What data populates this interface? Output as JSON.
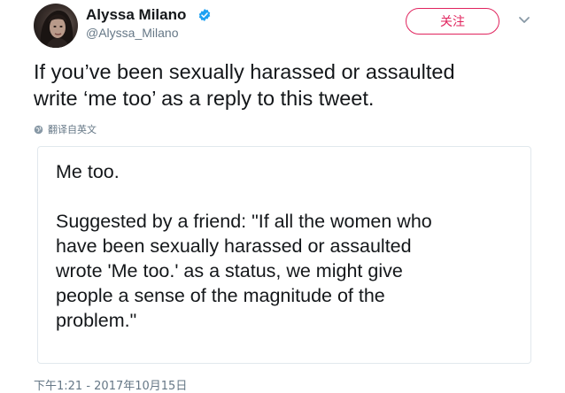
{
  "user": {
    "name": "Alyssa Milano",
    "handle": "@Alyssa_Milano",
    "verified": true,
    "verified_icon": "verified-badge-icon",
    "avatar_icon": "profile-avatar"
  },
  "actions": {
    "follow_label": "关注",
    "follow_color": "#e0245e",
    "menu_icon": "chevron-down-icon"
  },
  "tweet": {
    "lines": [
      "If you’ve been sexually harassed or assaulted",
      "write ‘me too’ as a reply to this tweet."
    ]
  },
  "translate": {
    "label": "翻译自英文",
    "icon": "globe-icon"
  },
  "card": {
    "line1": "Me too.",
    "body_lines": [
      "Suggested by a friend: \"If all the women who",
      "have been sexually harassed or assaulted",
      "wrote 'Me too.' as a status, we might give",
      "people a sense of the magnitude of the",
      "problem.\""
    ]
  },
  "timestamp": "下午1:21 - 2017年10月15日",
  "colors": {
    "text": "#14171a",
    "secondary": "#657786",
    "verified_blue": "#1da1f2",
    "border": "#e1e8ed"
  }
}
